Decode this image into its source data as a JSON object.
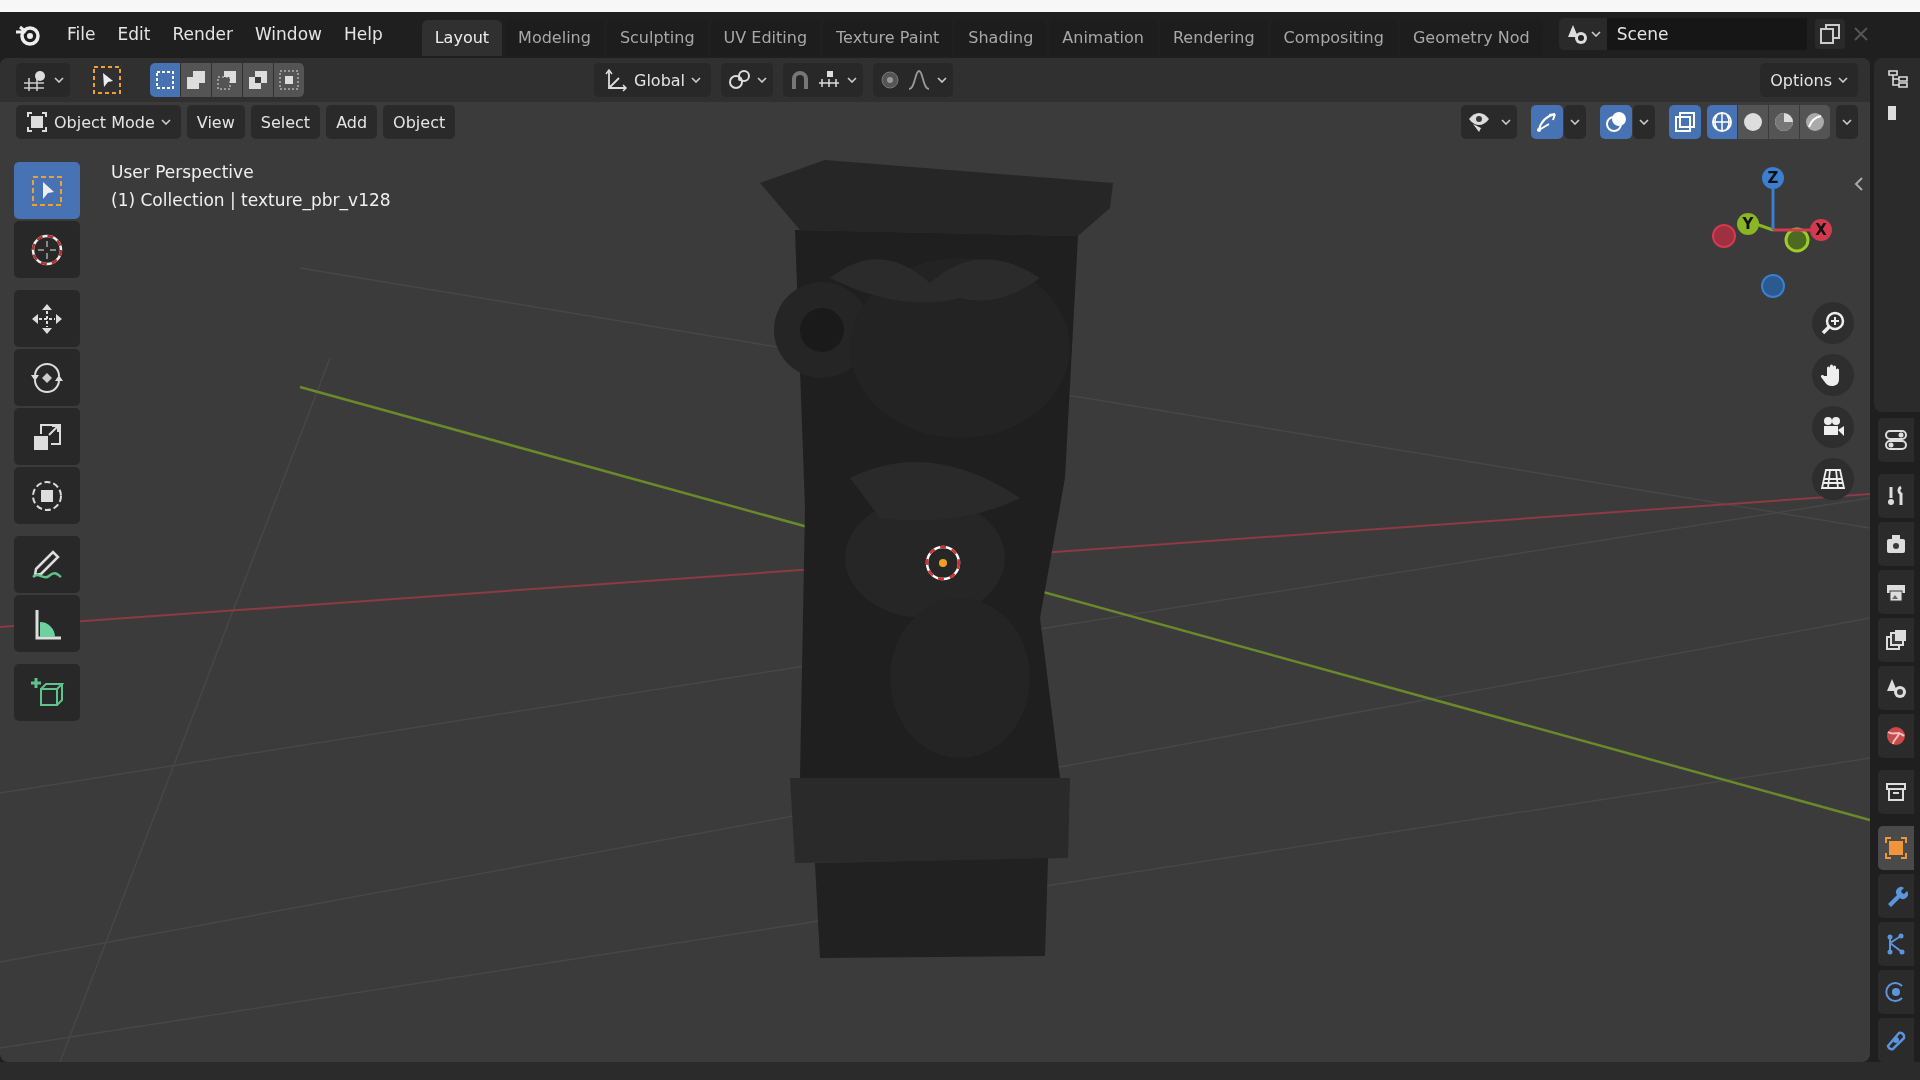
{
  "menu": [
    "File",
    "Edit",
    "Render",
    "Window",
    "Help"
  ],
  "workspace_tabs": [
    {
      "label": "Layout",
      "selected": true
    },
    {
      "label": "Modeling",
      "selected": false
    },
    {
      "label": "Sculpting",
      "selected": false
    },
    {
      "label": "UV Editing",
      "selected": false
    },
    {
      "label": "Texture Paint",
      "selected": false
    },
    {
      "label": "Shading",
      "selected": false
    },
    {
      "label": "Animation",
      "selected": false
    },
    {
      "label": "Rendering",
      "selected": false
    },
    {
      "label": "Compositing",
      "selected": false
    },
    {
      "label": "Geometry Nod",
      "selected": false
    }
  ],
  "scene": {
    "name": "Scene"
  },
  "tool_header": {
    "select_modes": [
      {
        "kind": "set",
        "selected": true
      },
      {
        "kind": "extend",
        "selected": false
      },
      {
        "kind": "subtract",
        "selected": false
      },
      {
        "kind": "invert",
        "selected": false
      },
      {
        "kind": "intersect",
        "selected": false
      }
    ],
    "orientation": "Global",
    "snap": {
      "on": false
    },
    "proportional_editing": {
      "on": false
    },
    "options": "Options"
  },
  "viewport_header": {
    "mode": "Object Mode",
    "menus": [
      "View",
      "Select",
      "Add",
      "Object"
    ],
    "toggles": [
      {
        "kind": "gizmo",
        "on": true
      },
      {
        "kind": "overlay",
        "on": true
      },
      {
        "kind": "xray",
        "on": true
      }
    ],
    "shading_modes": [
      {
        "kind": "wireframe",
        "selected": true
      },
      {
        "kind": "solid",
        "selected": false
      },
      {
        "kind": "material",
        "selected": false
      },
      {
        "kind": "rendered",
        "selected": false
      }
    ]
  },
  "viewport": {
    "view_name": "User Perspective",
    "collection": "(1) Collection | texture_pbr_v128",
    "gizmo": {
      "z": "Z",
      "y": "Y",
      "x": "X"
    }
  },
  "toolbar": [
    {
      "kind": "select_box",
      "selected": true
    },
    {
      "kind": "cursor",
      "selected": false
    },
    {
      "kind": "move",
      "selected": false
    },
    {
      "kind": "rotate",
      "selected": false
    },
    {
      "kind": "scale",
      "selected": false
    },
    {
      "kind": "transform",
      "selected": false
    },
    {
      "kind": "annotate",
      "selected": false
    },
    {
      "kind": "measure",
      "selected": false
    },
    {
      "kind": "add_cube",
      "selected": false
    }
  ],
  "properties_tabs": [
    {
      "kind": "tool",
      "selected": false
    },
    {
      "kind": "render",
      "selected": false
    },
    {
      "kind": "output",
      "selected": false
    },
    {
      "kind": "view_layer",
      "selected": false
    },
    {
      "kind": "scene",
      "selected": false
    },
    {
      "kind": "world",
      "selected": false
    },
    {
      "kind": "collection",
      "selected": false
    },
    {
      "kind": "object",
      "selected": true
    },
    {
      "kind": "modifiers",
      "selected": false
    },
    {
      "kind": "particles",
      "selected": false
    },
    {
      "kind": "physics",
      "selected": false
    },
    {
      "kind": "constraints",
      "selected": false
    }
  ]
}
